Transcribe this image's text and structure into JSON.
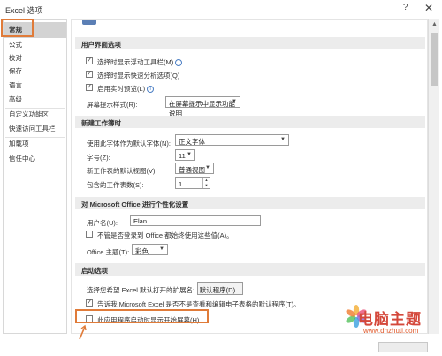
{
  "window": {
    "title": "Excel 选项",
    "help_icon": "?",
    "close_icon": "✕"
  },
  "sidebar": {
    "items": [
      {
        "label": "常规",
        "active": true
      },
      {
        "label": "公式"
      },
      {
        "label": "校对"
      },
      {
        "label": "保存"
      },
      {
        "label": "语言"
      },
      {
        "label": "高级"
      },
      {
        "label": "自定义功能区"
      },
      {
        "label": "快速访问工具栏"
      },
      {
        "label": "加载项"
      },
      {
        "label": "信任中心"
      }
    ]
  },
  "ui_options": {
    "header": "用户界面选项",
    "mini_toolbar": {
      "label": "选择时显示浮动工具栏(M)",
      "checked": true
    },
    "quick_analysis": {
      "label": "选择时显示快速分析选项(Q)",
      "checked": true
    },
    "live_preview": {
      "label": "启用实时预览(L)",
      "checked": true
    },
    "screentip_label": "屏幕提示样式(R):",
    "screentip_value": "在屏幕提示中显示功能说明"
  },
  "new_workbook": {
    "header": "新建工作簿时",
    "font_label": "使用此字体作为默认字体(N):",
    "font_value": "正文字体",
    "size_label": "字号(Z):",
    "size_value": "11",
    "view_label": "新工作表的默认视图(V):",
    "view_value": "普通视图",
    "sheets_label": "包含的工作表数(S):",
    "sheets_value": "1"
  },
  "personalize": {
    "header": "对 Microsoft Office 进行个性化设置",
    "username_label": "用户名(U):",
    "username_value": "Elan",
    "always_use_label": "不管是否登录到 Office 都始终使用这些值(A)。",
    "always_use_checked": false,
    "theme_label": "Office 主题(T):",
    "theme_value": "彩色"
  },
  "startup": {
    "header": "启动选项",
    "extensions_label": "选择您希望 Excel 默认打开的扩展名:",
    "default_programs_button": "默认程序(D)...",
    "not_default_label": "告诉我 Microsoft Excel 是否不是查看和编辑电子表格的默认程序(T)。",
    "not_default_checked": true,
    "start_screen_label": "此应用程序启动时显示开始屏幕(H)",
    "start_screen_checked": false
  },
  "watermark": {
    "title": "电脑主题",
    "url": "www.dnzhuti.com"
  },
  "colors": {
    "highlight": "#e07b39",
    "watermark_red": "#d4483b"
  }
}
